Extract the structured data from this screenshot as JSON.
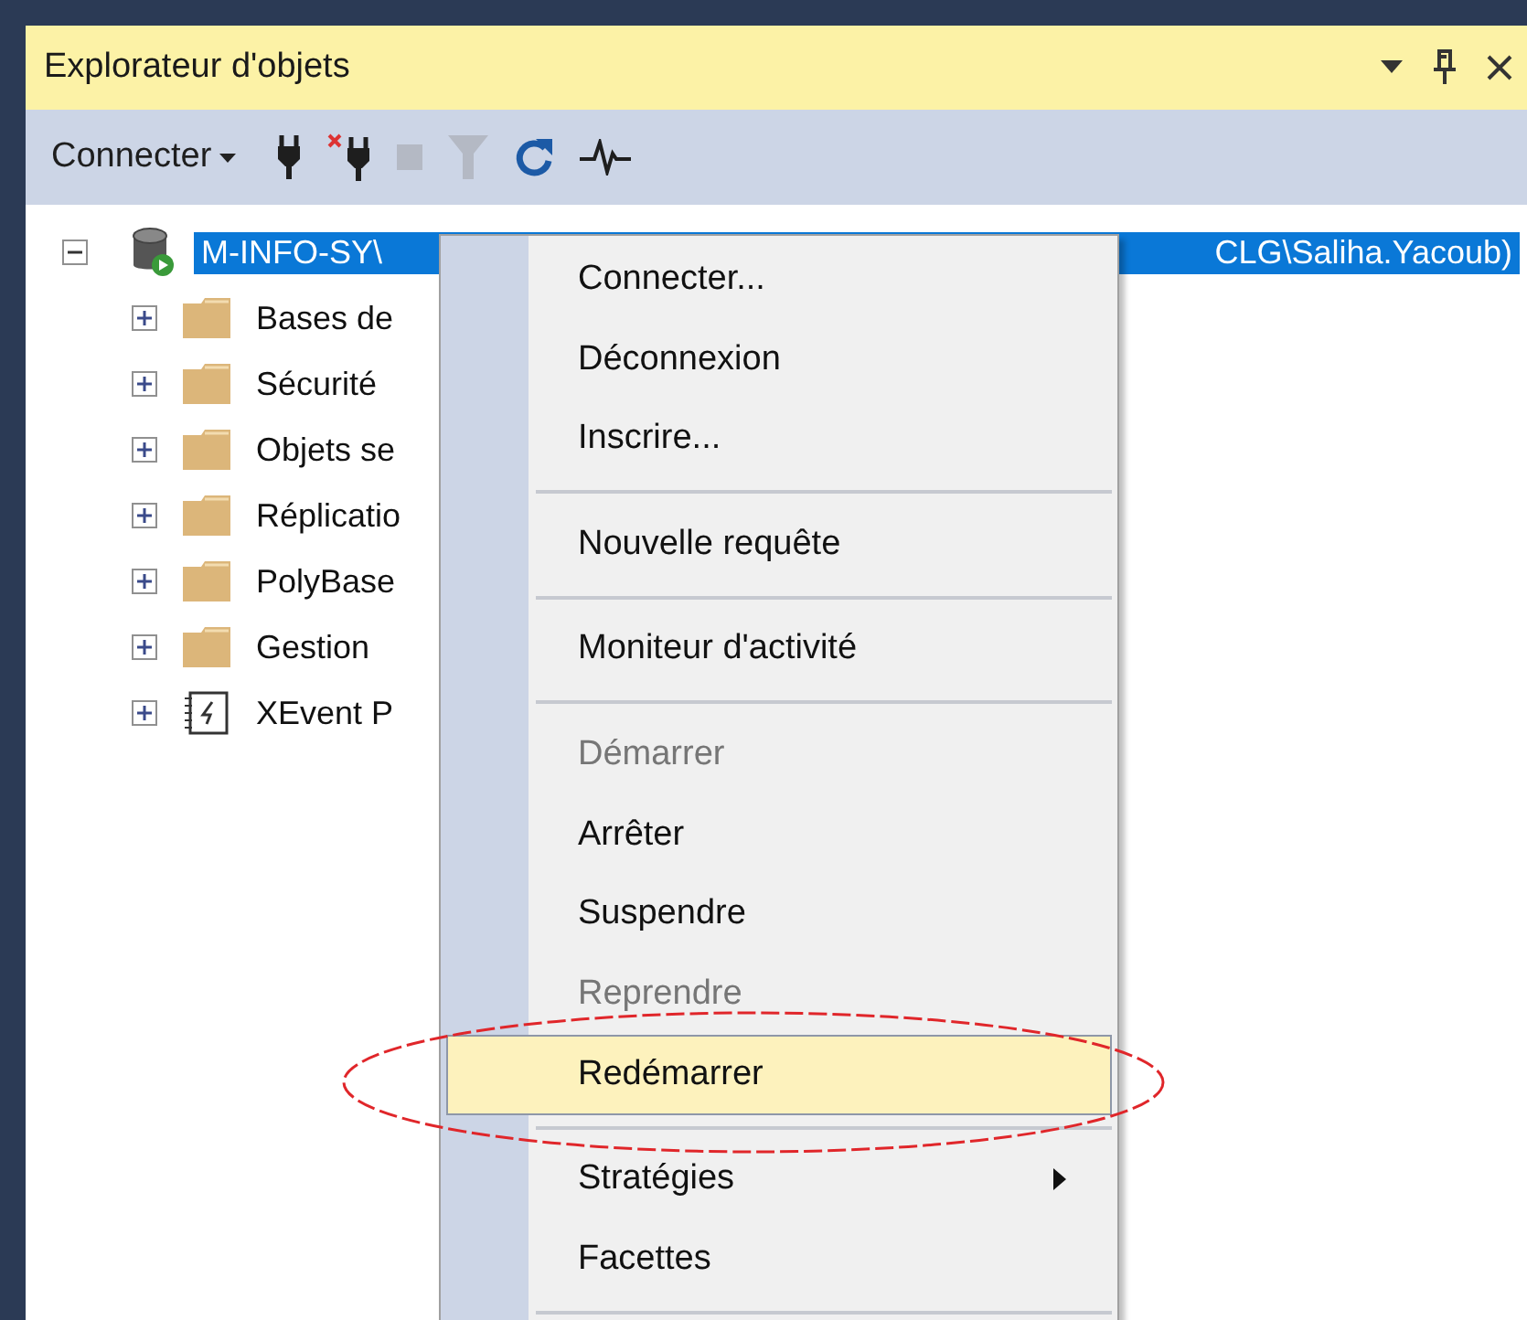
{
  "panel": {
    "title": "Explorateur d'objets"
  },
  "toolbar": {
    "connect_label": "Connecter",
    "tools": [
      {
        "kind": "plug",
        "disabled": false
      },
      {
        "kind": "disconnect",
        "disabled": false
      },
      {
        "kind": "stop",
        "disabled": true
      },
      {
        "kind": "filter",
        "disabled": true
      },
      {
        "kind": "refresh",
        "disabled": false
      },
      {
        "kind": "activity",
        "disabled": false
      }
    ]
  },
  "tree": {
    "server": {
      "label_start": "M-INFO-SY\\",
      "label_end": "CLG\\Saliha.Yacoub)",
      "expanded": true,
      "selected": true
    },
    "children": [
      {
        "kind": "folder",
        "label": "Bases de",
        "expanded": false
      },
      {
        "kind": "folder",
        "label": "Sécurité",
        "expanded": false
      },
      {
        "kind": "folder",
        "label": "Objets se",
        "expanded": false
      },
      {
        "kind": "folder",
        "label": "Réplicatio",
        "expanded": false
      },
      {
        "kind": "folder",
        "label": "PolyBase",
        "expanded": false
      },
      {
        "kind": "folder",
        "label": "Gestion",
        "expanded": false
      },
      {
        "kind": "xevent",
        "label": "XEvent P",
        "expanded": false
      }
    ]
  },
  "context_menu": [
    {
      "kind": "item",
      "label": "Connecter...",
      "disabled": false,
      "selected": false,
      "has_submenu": false
    },
    {
      "kind": "item",
      "label": "Déconnexion",
      "disabled": false,
      "selected": false,
      "has_submenu": false
    },
    {
      "kind": "item",
      "label": "Inscrire...",
      "disabled": false,
      "selected": false,
      "has_submenu": false
    },
    {
      "kind": "separator"
    },
    {
      "kind": "item",
      "label": "Nouvelle requête",
      "disabled": false,
      "selected": false,
      "has_submenu": false
    },
    {
      "kind": "separator"
    },
    {
      "kind": "item",
      "label": "Moniteur d'activité",
      "disabled": false,
      "selected": false,
      "has_submenu": false
    },
    {
      "kind": "separator"
    },
    {
      "kind": "item",
      "label": "Démarrer",
      "disabled": true,
      "selected": false,
      "has_submenu": false
    },
    {
      "kind": "item",
      "label": "Arrêter",
      "disabled": false,
      "selected": false,
      "has_submenu": false
    },
    {
      "kind": "item",
      "label": "Suspendre",
      "disabled": false,
      "selected": false,
      "has_submenu": false
    },
    {
      "kind": "item",
      "label": "Reprendre",
      "disabled": true,
      "selected": false,
      "has_submenu": false
    },
    {
      "kind": "item",
      "label": "Redémarrer",
      "disabled": false,
      "selected": true,
      "has_submenu": false
    },
    {
      "kind": "separator"
    },
    {
      "kind": "item",
      "label": "Stratégies",
      "disabled": false,
      "selected": false,
      "has_submenu": true
    },
    {
      "kind": "item",
      "label": "Facettes",
      "disabled": false,
      "selected": false,
      "has_submenu": false
    },
    {
      "kind": "separator"
    }
  ],
  "annotations": [
    {
      "kind": "ellipse"
    }
  ]
}
